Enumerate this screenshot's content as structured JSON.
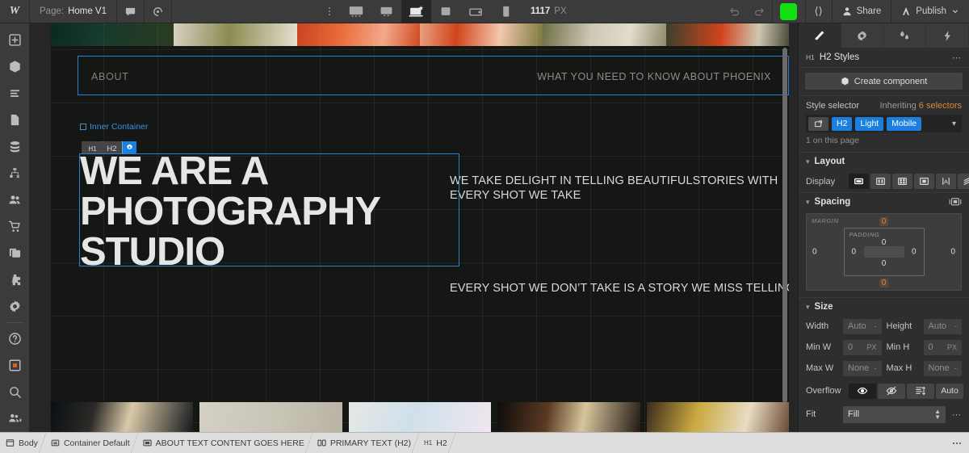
{
  "topbar": {
    "logo": "W",
    "page_label": "Page:",
    "page_name": "Home V1",
    "comment_icon": "comment-icon",
    "preview_icon": "eye-preview-icon",
    "more_icon": "more-vertical-icon",
    "breakpoints": [
      {
        "name": "desktop-large",
        "icon": "monitor-icon",
        "active": false
      },
      {
        "name": "desktop",
        "icon": "desktop-icon",
        "active": false
      },
      {
        "name": "laptop-base",
        "icon": "laptop-star-icon",
        "active": true
      },
      {
        "name": "tablet",
        "icon": "tablet-icon",
        "active": false
      },
      {
        "name": "mobile-landscape",
        "icon": "mobile-landscape-icon",
        "active": false
      },
      {
        "name": "mobile-portrait",
        "icon": "mobile-portrait-icon",
        "active": false
      }
    ],
    "viewport_width": "1117",
    "viewport_unit": "PX",
    "undo_icon": "undo-icon",
    "redo_icon": "redo-icon",
    "status_color": "#13e013",
    "code_icon": "code-brackets-icon",
    "share_label": "Share",
    "publish_label": "Publish"
  },
  "rail": {
    "items": [
      {
        "name": "add-elements",
        "icon": "plus-square-icon"
      },
      {
        "name": "components",
        "icon": "cube-icon"
      },
      {
        "name": "navigator",
        "icon": "layers-lines-icon"
      },
      {
        "name": "pages",
        "icon": "page-document-icon"
      },
      {
        "name": "cms-collections",
        "icon": "database-icon"
      },
      {
        "name": "logic",
        "icon": "flow-node-icon"
      },
      {
        "name": "users",
        "icon": "users-icon"
      },
      {
        "name": "ecommerce",
        "icon": "shopping-cart-icon"
      },
      {
        "name": "assets",
        "icon": "image-stack-icon"
      },
      {
        "name": "apps",
        "icon": "puzzle-piece-icon"
      },
      {
        "name": "settings",
        "icon": "gear-icon"
      },
      {
        "name": "help",
        "icon": "question-circle-icon"
      },
      {
        "name": "video-tutorials",
        "icon": "square-dot-icon"
      },
      {
        "name": "search",
        "icon": "magnifier-icon"
      },
      {
        "name": "collaborators",
        "icon": "video-camera-people-icon"
      }
    ]
  },
  "canvas": {
    "about_label": "ABOUT",
    "about_right_label": "WHAT YOU NEED TO KNOW ABOUT PHOENIX",
    "inner_container_badge": "Inner Container",
    "selection_badge": {
      "tag1": "H1",
      "tag2": "H2",
      "gear": "gear-icon"
    },
    "headline": "WE ARE A PHOTOGRAPHY STUDIO",
    "paragraph_1": "WE TAKE DELIGHT IN TELLING BEAUTIFULSTORIES WITH EVERY SHOT WE TAKE",
    "paragraph_2": "EVERY SHOT WE DON’T TAKE IS A STORY WE MISS TELLING",
    "background_color": "#141713",
    "selection_color": "#2f7fd4"
  },
  "right_panel": {
    "tabs": [
      {
        "name": "style",
        "icon": "paintbrush-icon",
        "active": true
      },
      {
        "name": "settings",
        "icon": "gear-icon",
        "active": false
      },
      {
        "name": "interactions",
        "icon": "droplets-icon",
        "active": false
      },
      {
        "name": "effects",
        "icon": "lightning-bolt-icon",
        "active": false
      }
    ],
    "selector_header": {
      "tag": "H1",
      "title": "H2 Styles",
      "menu": "⋯"
    },
    "create_component_label": "Create component",
    "style_selector": {
      "label": "Style selector",
      "inheriting_prefix": "Inheriting",
      "inheriting_count": "6 selectors",
      "chips": [
        "H2",
        "Light",
        "Mobile"
      ],
      "on_this_page": "1 on this page",
      "chip_color": "#1b7fe0",
      "accent_color": "#e0863a"
    },
    "layout": {
      "title": "Layout",
      "display_label": "Display",
      "options": [
        {
          "name": "display-block",
          "icon": "block-icon",
          "active": true
        },
        {
          "name": "display-flex",
          "icon": "flex-icon",
          "active": false
        },
        {
          "name": "display-grid",
          "icon": "grid-icon",
          "active": false
        },
        {
          "name": "display-inline-block",
          "icon": "inline-block-icon",
          "active": false
        },
        {
          "name": "display-inline",
          "icon": "inline-text-icon",
          "active": false
        },
        {
          "name": "display-none",
          "icon": "none-slash-icon",
          "active": false
        }
      ]
    },
    "spacing": {
      "title": "Spacing",
      "margin_label": "MARGIN",
      "padding_label": "PADDING",
      "margin": {
        "top": "0",
        "right": "0",
        "bottom": "0",
        "left": "0"
      },
      "padding": {
        "top": "0",
        "right": "0",
        "bottom": "0",
        "left": "0"
      }
    },
    "size": {
      "title": "Size",
      "width_label": "Width",
      "width_value": "Auto",
      "width_unit": "-",
      "height_label": "Height",
      "height_value": "Auto",
      "height_unit": "-",
      "min_w_label": "Min W",
      "min_w_value": "0",
      "min_w_unit": "PX",
      "min_h_label": "Min H",
      "min_h_value": "0",
      "min_h_unit": "PX",
      "max_w_label": "Max W",
      "max_w_value": "None",
      "max_w_unit": "-",
      "max_h_label": "Max H",
      "max_h_value": "None",
      "max_h_unit": "-",
      "overflow_label": "Overflow",
      "overflow_options": [
        {
          "name": "overflow-visible",
          "icon": "eye-icon",
          "label": "",
          "active": true
        },
        {
          "name": "overflow-hidden",
          "icon": "eye-slash-icon",
          "label": "",
          "active": false
        },
        {
          "name": "overflow-scroll",
          "icon": "scroll-icon",
          "label": "",
          "active": false
        },
        {
          "name": "overflow-auto",
          "icon": "",
          "label": "Auto",
          "active": false
        }
      ],
      "fit_label": "Fit",
      "fit_value": "Fill"
    }
  },
  "breadcrumb": {
    "items": [
      {
        "label": "Body",
        "icon": "body-icon"
      },
      {
        "label": "Container Default",
        "icon": "container-icon"
      },
      {
        "label": "ABOUT TEXT CONTENT GOES HERE",
        "icon": "section-icon"
      },
      {
        "label": "PRIMARY TEXT (H2)",
        "icon": "columns-icon"
      },
      {
        "label": "H2",
        "icon": "",
        "tag": "H1"
      }
    ],
    "more_icon": "more-horizontal-icon"
  }
}
